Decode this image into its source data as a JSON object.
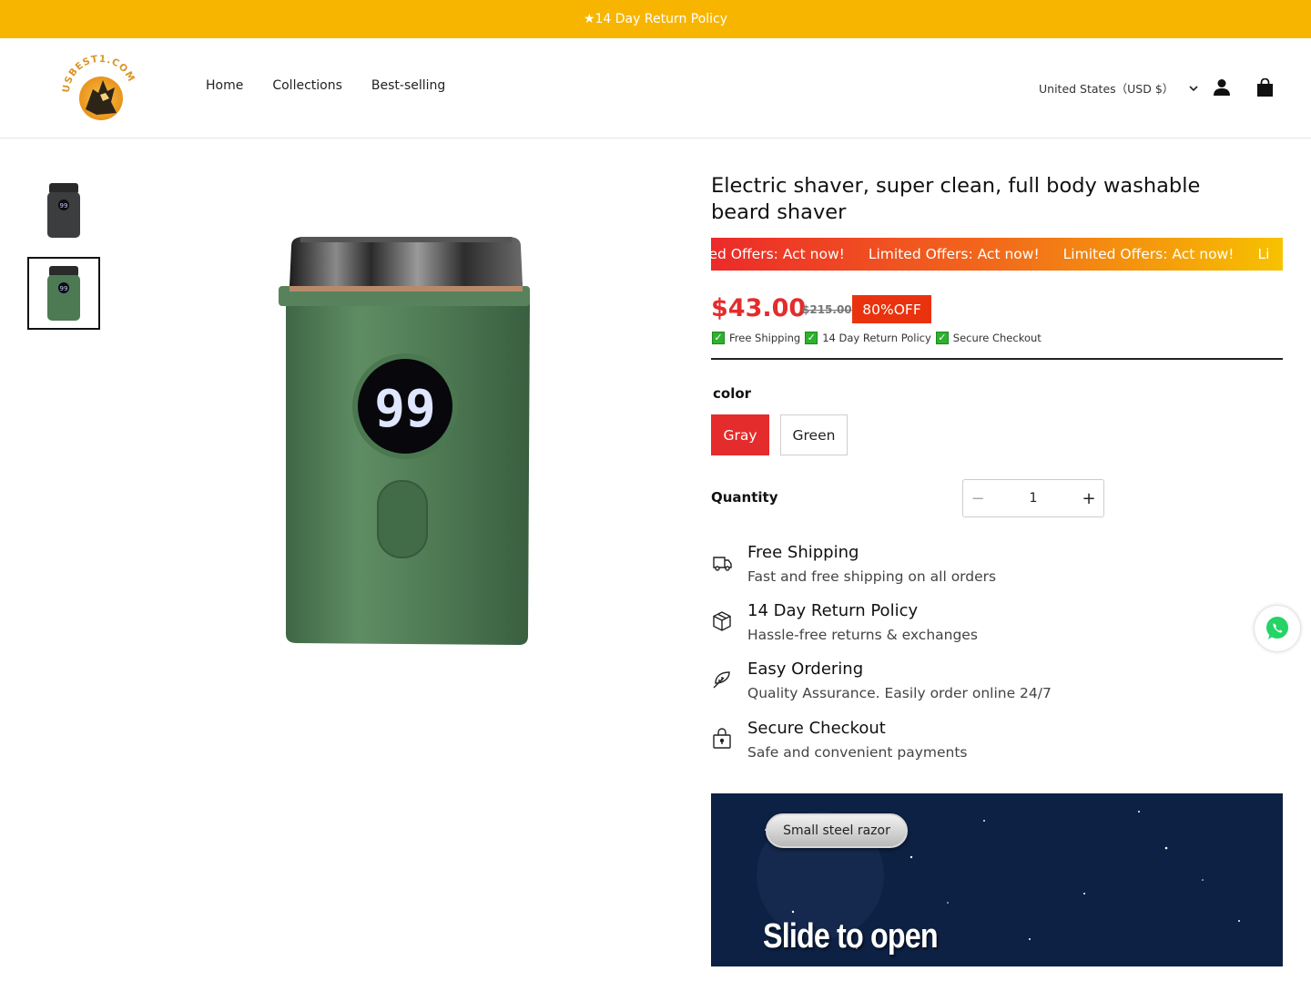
{
  "announcement": {
    "text": "★14 Day Return Policy"
  },
  "header": {
    "logo_text": "USBEST1.COM",
    "nav": [
      "Home",
      "Collections",
      "Best-selling"
    ],
    "locale": "United States（USD $）"
  },
  "product": {
    "title": "Electric shaver, super clean, full body washable beard shaver",
    "marquee": [
      "mited Offers: Act now!",
      "Limited Offers: Act now!",
      "Limited Offers: Act now!",
      "Li"
    ],
    "price": "$43.00",
    "compare_price": "$215.00",
    "discount_badge": "80%OFF",
    "trust": [
      "Free Shipping",
      "14 Day Return Policy",
      "Secure Checkout"
    ],
    "option_label": "color",
    "options": [
      "Gray",
      "Green"
    ],
    "selected_option": "Gray",
    "quantity_label": "Quantity",
    "quantity": "1",
    "display_number": "99"
  },
  "features": [
    {
      "icon": "truck-icon",
      "title": "Free Shipping",
      "desc": "Fast and free shipping on all orders"
    },
    {
      "icon": "box-icon",
      "title": "14 Day Return Policy",
      "desc": "Hassle-free returns & exchanges"
    },
    {
      "icon": "leaf-icon",
      "title": "Easy Ordering",
      "desc": "Quality Assurance. Easily order online 24/7"
    },
    {
      "icon": "lock-bag-icon",
      "title": "Secure Checkout",
      "desc": "Safe and convenient payments"
    }
  ],
  "banner": {
    "pill": "Small steel razor",
    "headline": "Slide to open"
  },
  "colors": {
    "announcement_bg": "#f7b500",
    "accent_red": "#e42c2c",
    "badge_orange": "#e9330e",
    "body_green": "#4d7a52"
  }
}
